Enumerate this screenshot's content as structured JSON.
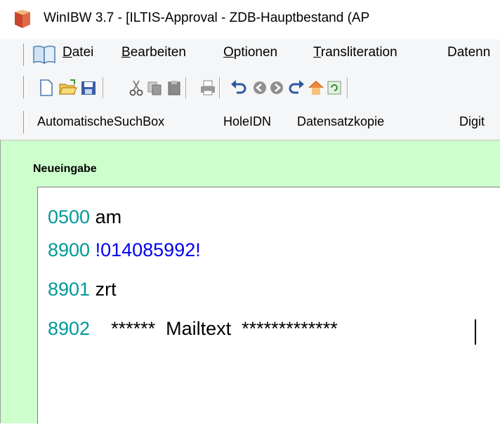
{
  "window": {
    "title": "WinIBW 3.7 - [ILTIS-Approval - ZDB-Hauptbestand (AP"
  },
  "menu": [
    {
      "label": "Datei",
      "accel": "D",
      "rest": "atei"
    },
    {
      "label": "Bearbeiten",
      "accel": "B",
      "rest": "earbeiten"
    },
    {
      "label": "Optionen",
      "accel": "O",
      "rest": "ptionen"
    },
    {
      "label": "Transliteration",
      "accel": "T",
      "rest": "ransliteration"
    },
    {
      "label": "Datenn",
      "accel": "",
      "rest": "Datenn"
    }
  ],
  "toolbar": {
    "icons": [
      "new-document-icon",
      "open-folder-icon",
      "save-icon",
      "cut-icon",
      "copy-icon",
      "paste-icon",
      "print-icon",
      "undo-icon",
      "back-icon",
      "forward-icon",
      "redo-icon",
      "home-icon",
      "refresh-icon"
    ]
  },
  "scripts": [
    "AutomatischeSuchBox",
    "HoleIDN",
    "Datensatzkopie",
    "Digit"
  ],
  "panel": {
    "label": "Neueingabe"
  },
  "record": [
    {
      "tag": "0500",
      "value": " am",
      "link": false
    },
    {
      "tag": "8900",
      "value": " !014085992!",
      "link": true
    },
    {
      "tag": "8901",
      "value": " zrt",
      "link": false
    },
    {
      "tag": "8902",
      "value": "    ******  Mailtext  *************",
      "link": false
    }
  ],
  "colors": {
    "panel_bg": "#ccffcc",
    "tag_color": "#009999",
    "link_color": "#0000ee"
  }
}
